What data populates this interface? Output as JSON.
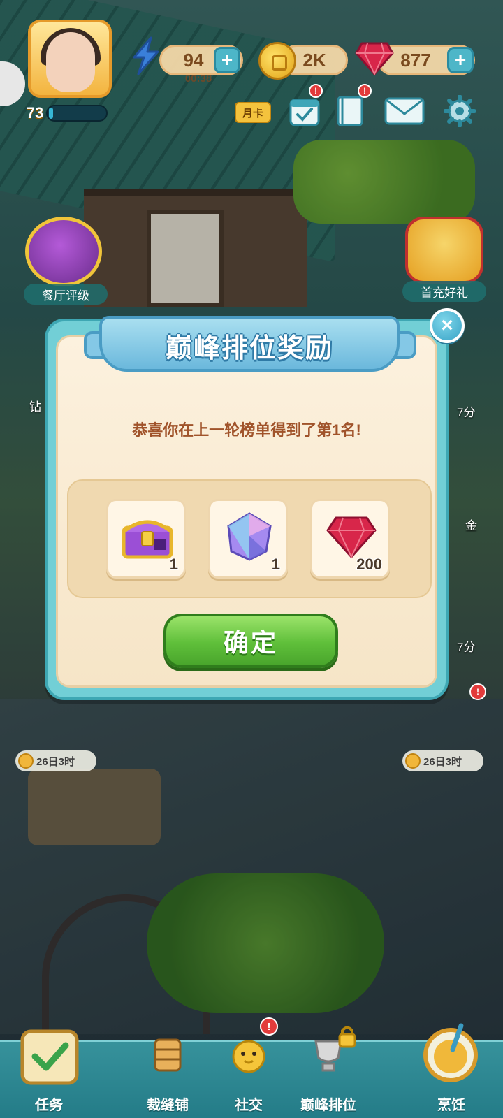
{
  "hud": {
    "level": "73",
    "level_progress": 0.08,
    "energy": {
      "value": "94",
      "timer": "00:38",
      "plus": "+"
    },
    "coins": {
      "value": "2K"
    },
    "gems": {
      "value": "877",
      "plus": "+"
    },
    "month_card_label": "月卡",
    "alert_mark": "!"
  },
  "side": {
    "left": [
      {
        "label": "餐厅评级"
      },
      {
        "partial": "钻"
      }
    ],
    "right": [
      {
        "label": "首充好礼"
      },
      {
        "partial": "7分"
      },
      {
        "partial": "金"
      },
      {
        "partial": "7分"
      }
    ],
    "bottom_left_timer": "26日3时",
    "bottom_right_timer": "26日3时"
  },
  "modal": {
    "title": "巅峰排位奖励",
    "close_label": "×",
    "message": "恭喜你在上一轮榜单得到了第1名!",
    "rewards": [
      {
        "name": "treasure-chest",
        "qty": "1"
      },
      {
        "name": "crystal",
        "qty": "1"
      },
      {
        "name": "ruby-gem",
        "qty": "200"
      }
    ],
    "confirm_label": "确定"
  },
  "bottom_nav": {
    "items": [
      {
        "label": "任务"
      },
      {
        "label": "裁缝铺"
      },
      {
        "label": "社交"
      },
      {
        "label": "巅峰排位"
      },
      {
        "label": "烹饪"
      }
    ]
  },
  "colors": {
    "modal_frame": "#72cfd6",
    "modal_body": "#fcf1de",
    "confirm_green": "#5fbf3a",
    "message_text": "#a0532a",
    "gem_red": "#d8264a"
  }
}
